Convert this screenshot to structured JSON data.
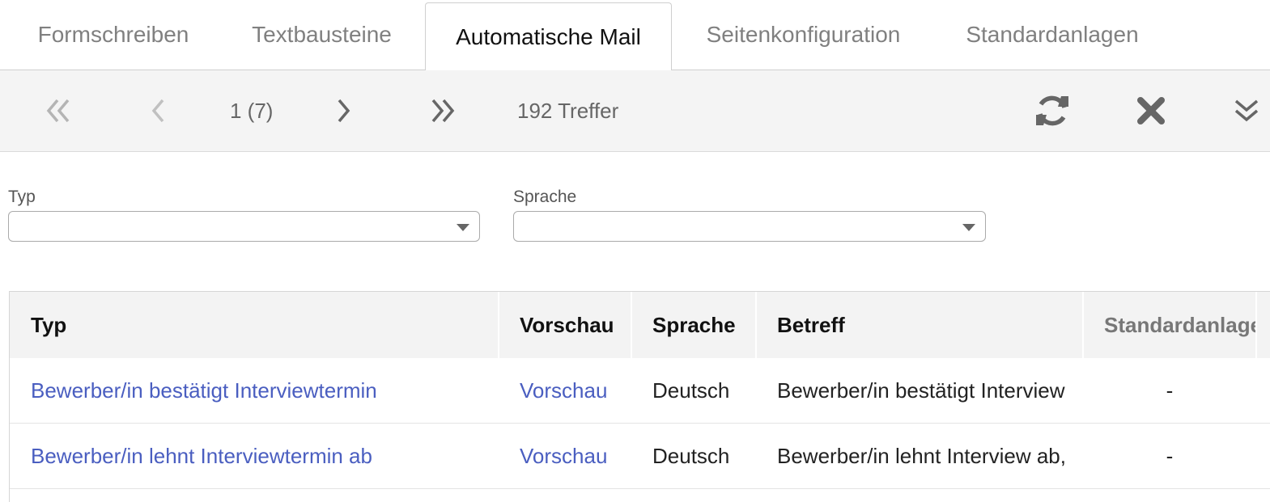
{
  "tabs": [
    {
      "label": "Formschreiben"
    },
    {
      "label": "Textbausteine"
    },
    {
      "label": "Automatische Mail",
      "active": true
    },
    {
      "label": "Seitenkonfiguration"
    },
    {
      "label": "Standardanlagen"
    }
  ],
  "toolbar": {
    "first_icon": "double-chevron-left-icon",
    "prev_icon": "chevron-left-icon",
    "page_indicator": "1 (7)",
    "next_icon": "chevron-right-icon",
    "last_icon": "double-chevron-right-icon",
    "hits": "192 Treffer",
    "refresh_icon": "refresh-icon",
    "clear_icon": "close-icon",
    "expand_icon": "double-chevron-down-icon"
  },
  "filters": {
    "typ_label": "Typ",
    "typ_value": "",
    "sprache_label": "Sprache",
    "sprache_value": ""
  },
  "table": {
    "headers": [
      "Typ",
      "Vorschau",
      "Sprache",
      "Betreff",
      "Standardanlage"
    ],
    "rows": [
      {
        "typ": "Bewerber/in bestätigt Interviewtermin",
        "vorschau": "Vorschau",
        "sprache": "Deutsch",
        "betreff": "Bewerber/in bestätigt Interview",
        "standardanlage": "-"
      },
      {
        "typ": "Bewerber/in lehnt Interviewtermin ab",
        "vorschau": "Vorschau",
        "sprache": "Deutsch",
        "betreff": "Bewerber/in lehnt Interview ab,",
        "standardanlage": "-"
      }
    ]
  },
  "colors": {
    "link": "#4a5ec0",
    "toolbar_bg": "#f4f4f4",
    "icon": "#666666"
  }
}
